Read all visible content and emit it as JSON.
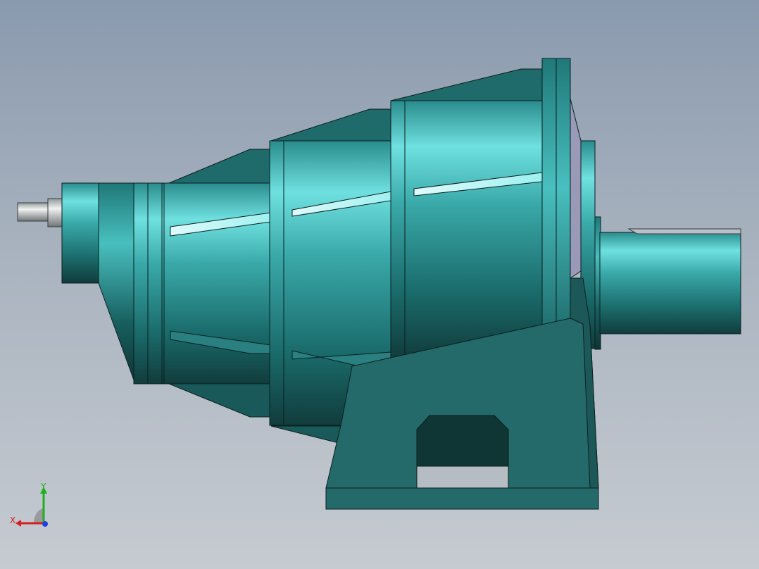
{
  "viewport": {
    "background_top": "#8a9aae",
    "background_bottom": "#c6cbd1"
  },
  "model": {
    "subject": "gearbox-3d-model",
    "colors": {
      "teal_light": "#7fe6e6",
      "teal_mid": "#3aa9a9",
      "teal_dark": "#155656",
      "teal_darkest": "#0f3535",
      "edge": "#0a1e1e",
      "shaft_steel": "#c9c9c9",
      "flange_face": "#9a9ab8"
    }
  },
  "triad": {
    "x_label": "X",
    "y_label": "Y",
    "x_color": "#d42020",
    "y_color": "#20b020",
    "z_color": "#2040e0"
  }
}
